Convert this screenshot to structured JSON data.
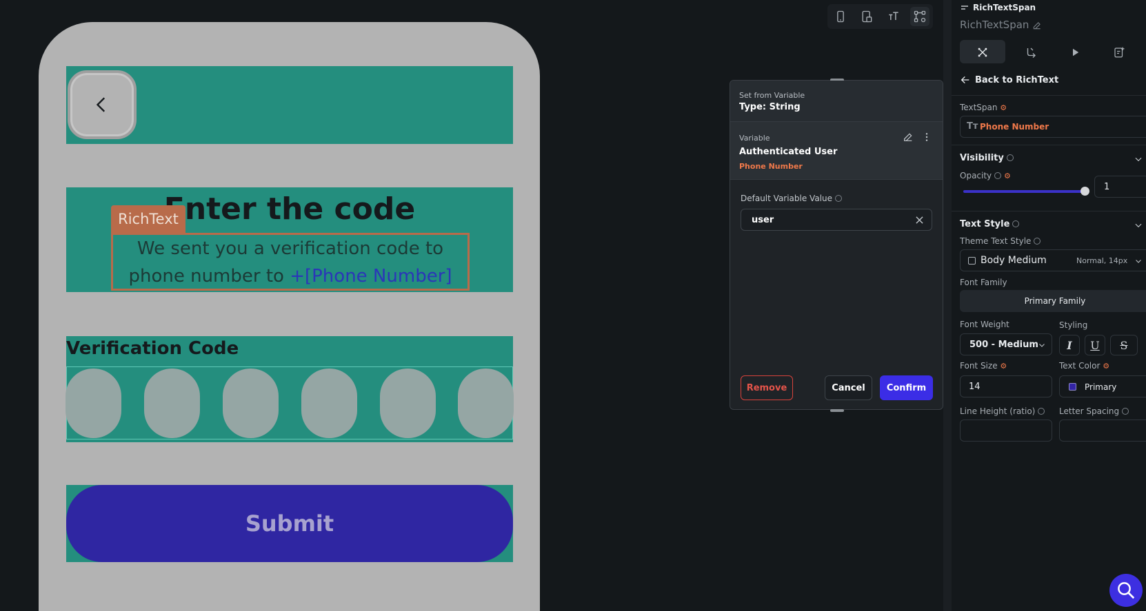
{
  "canvas": {
    "title": "Enter the code",
    "richtext_tag": "RichText",
    "rich_line1": "We sent you a verification code to",
    "rich_line2_prefix": "phone number to ",
    "rich_line2_var": "+[Phone Number]",
    "code_label": "Verification Code",
    "submit_label": "Submit",
    "code_slots": 6
  },
  "device_toolbar": {
    "items": [
      "phone-icon",
      "tablet-icon",
      "text-size-icon",
      "widget-tree-icon"
    ]
  },
  "popover": {
    "header_small": "Set from Variable",
    "header_type": "Type: String",
    "var_small": "Variable",
    "var_name": "Authenticated User",
    "var_field": "Phone Number",
    "default_label": "Default Variable Value",
    "default_value": "user",
    "remove": "Remove",
    "cancel": "Cancel",
    "confirm": "Confirm"
  },
  "panel": {
    "widget_type": "RichTextSpan",
    "widget_name": "RichTextSpan",
    "back_label": "Back to RichText",
    "textspan_label": "TextSpan",
    "textspan_value": "Phone Number",
    "visibility_label": "Visibility",
    "opacity_label": "Opacity",
    "opacity_value": "1",
    "opacity_level": 1.0,
    "text_style_label": "Text Style",
    "theme_text_style_label": "Theme Text Style",
    "theme_text_style_value": "Body Medium",
    "theme_text_style_meta": "Normal, 14px",
    "font_family_label": "Font Family",
    "font_family_value": "Primary Family",
    "font_weight_label": "Font Weight",
    "font_weight_value": "500 - Medium",
    "styling_label": "Styling",
    "font_size_label": "Font Size",
    "font_size_value": "14",
    "text_color_label": "Text Color",
    "text_color_value": "Primary",
    "line_height_label": "Line Height (ratio)",
    "letter_spacing_label": "Letter Spacing"
  },
  "colors": {
    "accent": "#3b2de6",
    "highlight": "#f0794a",
    "canvas_block": "#248e7e",
    "primary_swatch": "#3324a6"
  }
}
